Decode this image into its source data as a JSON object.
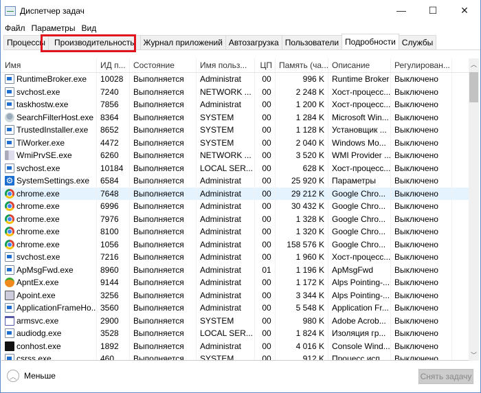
{
  "window": {
    "title": "Диспетчер задач",
    "minimize": "—",
    "maximize": "☐",
    "close": "✕"
  },
  "menu": [
    "Файл",
    "Параметры",
    "Вид"
  ],
  "tabs": [
    "Процессы",
    "Производительность",
    "Журнал приложений",
    "Автозагрузка",
    "Пользователи",
    "Подробности",
    "Службы"
  ],
  "active_tab": "Подробности",
  "highlighted_tab": "Производительность",
  "highlight_color": "#e0141e",
  "columns": [
    "Имя",
    "ИД п...",
    "Состояние",
    "Имя польз...",
    "ЦП",
    "Память (ча...",
    "Описание",
    "Регулирован..."
  ],
  "rows": [
    {
      "icon": "exe",
      "name": "RuntimeBroker.exe",
      "pid": "10028",
      "state": "Выполняется",
      "user": "Administrat",
      "cpu": "00",
      "mem": "996 K",
      "desc": "Runtime Broker",
      "reg": "Выключено"
    },
    {
      "icon": "exe",
      "name": "svchost.exe",
      "pid": "7240",
      "state": "Выполняется",
      "user": "NETWORK ...",
      "cpu": "00",
      "mem": "2 248 K",
      "desc": "Хост-процесс...",
      "reg": "Выключено"
    },
    {
      "icon": "exe",
      "name": "taskhostw.exe",
      "pid": "7856",
      "state": "Выполняется",
      "user": "Administrat",
      "cpu": "00",
      "mem": "1 200 K",
      "desc": "Хост-процесс...",
      "reg": "Выключено"
    },
    {
      "icon": "search",
      "name": "SearchFilterHost.exe",
      "pid": "8364",
      "state": "Выполняется",
      "user": "SYSTEM",
      "cpu": "00",
      "mem": "1 284 K",
      "desc": "Microsoft Win...",
      "reg": "Выключено"
    },
    {
      "icon": "exe",
      "name": "TrustedInstaller.exe",
      "pid": "8652",
      "state": "Выполняется",
      "user": "SYSTEM",
      "cpu": "00",
      "mem": "1 128 K",
      "desc": "Установщик ...",
      "reg": "Выключено"
    },
    {
      "icon": "exe",
      "name": "TiWorker.exe",
      "pid": "4472",
      "state": "Выполняется",
      "user": "SYSTEM",
      "cpu": "00",
      "mem": "2 040 K",
      "desc": "Windows Mo...",
      "reg": "Выключено"
    },
    {
      "icon": "wmi",
      "name": "WmiPrvSE.exe",
      "pid": "6260",
      "state": "Выполняется",
      "user": "NETWORK ...",
      "cpu": "00",
      "mem": "3 520 K",
      "desc": "WMI Provider ...",
      "reg": "Выключено"
    },
    {
      "icon": "exe",
      "name": "svchost.exe",
      "pid": "10184",
      "state": "Выполняется",
      "user": "LOCAL SER...",
      "cpu": "00",
      "mem": "628 K",
      "desc": "Хост-процесс...",
      "reg": "Выключено"
    },
    {
      "icon": "gear",
      "name": "SystemSettings.exe",
      "pid": "6584",
      "state": "Выполняется",
      "user": "Administrat",
      "cpu": "00",
      "mem": "25 920 K",
      "desc": "Параметры",
      "reg": "Выключено"
    },
    {
      "icon": "chrome",
      "name": "chrome.exe",
      "pid": "7648",
      "state": "Выполняется",
      "user": "Administrat",
      "cpu": "00",
      "mem": "29 212 K",
      "desc": "Google Chro...",
      "reg": "Выключено",
      "selected": true
    },
    {
      "icon": "chrome",
      "name": "chrome.exe",
      "pid": "6996",
      "state": "Выполняется",
      "user": "Administrat",
      "cpu": "00",
      "mem": "30 432 K",
      "desc": "Google Chro...",
      "reg": "Выключено"
    },
    {
      "icon": "chrome",
      "name": "chrome.exe",
      "pid": "7976",
      "state": "Выполняется",
      "user": "Administrat",
      "cpu": "00",
      "mem": "1 328 K",
      "desc": "Google Chro...",
      "reg": "Выключено"
    },
    {
      "icon": "chrome",
      "name": "chrome.exe",
      "pid": "8100",
      "state": "Выполняется",
      "user": "Administrat",
      "cpu": "00",
      "mem": "1 320 K",
      "desc": "Google Chro...",
      "reg": "Выключено"
    },
    {
      "icon": "chrome",
      "name": "chrome.exe",
      "pid": "1056",
      "state": "Выполняется",
      "user": "Administrat",
      "cpu": "00",
      "mem": "158 576 K",
      "desc": "Google Chro...",
      "reg": "Выключено"
    },
    {
      "icon": "exe",
      "name": "svchost.exe",
      "pid": "7216",
      "state": "Выполняется",
      "user": "Administrat",
      "cpu": "00",
      "mem": "1 960 K",
      "desc": "Хост-процесс...",
      "reg": "Выключено"
    },
    {
      "icon": "exe",
      "name": "ApMsgFwd.exe",
      "pid": "8960",
      "state": "Выполняется",
      "user": "Administrat",
      "cpu": "01",
      "mem": "1 196 K",
      "desc": "ApMsgFwd",
      "reg": "Выключено"
    },
    {
      "icon": "apnt",
      "name": "ApntEx.exe",
      "pid": "9144",
      "state": "Выполняется",
      "user": "Administrat",
      "cpu": "00",
      "mem": "1 172 K",
      "desc": "Alps Pointing-...",
      "reg": "Выключено"
    },
    {
      "icon": "apoint",
      "name": "Apoint.exe",
      "pid": "3256",
      "state": "Выполняется",
      "user": "Administrat",
      "cpu": "00",
      "mem": "3 344 K",
      "desc": "Alps Pointing-...",
      "reg": "Выключено"
    },
    {
      "icon": "exe",
      "name": "ApplicationFrameHo...",
      "pid": "3560",
      "state": "Выполняется",
      "user": "Administrat",
      "cpu": "00",
      "mem": "5 548 K",
      "desc": "Application Fr...",
      "reg": "Выключено"
    },
    {
      "icon": "arm",
      "name": "armsvc.exe",
      "pid": "2900",
      "state": "Выполняется",
      "user": "SYSTEM",
      "cpu": "00",
      "mem": "980 K",
      "desc": "Adobe Acrob...",
      "reg": "Выключено"
    },
    {
      "icon": "exe",
      "name": "audiodg.exe",
      "pid": "3528",
      "state": "Выполняется",
      "user": "LOCAL SER...",
      "cpu": "00",
      "mem": "1 824 K",
      "desc": "Изоляция гр...",
      "reg": "Выключено"
    },
    {
      "icon": "con",
      "name": "conhost.exe",
      "pid": "1892",
      "state": "Выполняется",
      "user": "Administrat",
      "cpu": "00",
      "mem": "4 016 K",
      "desc": "Console Wind...",
      "reg": "Выключено"
    },
    {
      "icon": "exe",
      "name": "csrss.exe",
      "pid": "460",
      "state": "Выполняется",
      "user": "SYSTEM",
      "cpu": "00",
      "mem": "912 K",
      "desc": "Процесс исп...",
      "reg": "Выключено"
    }
  ],
  "footer": {
    "less": "Меньше",
    "end_task": "Снять задачу"
  }
}
